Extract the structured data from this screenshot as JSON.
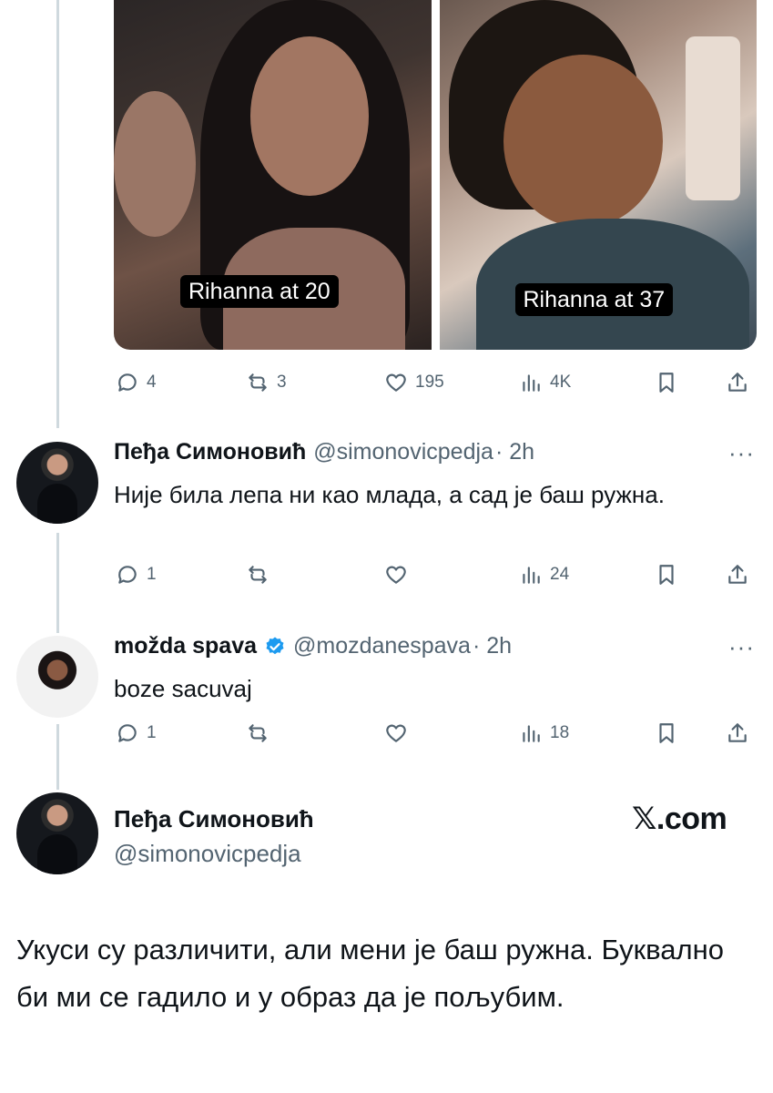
{
  "media": {
    "captions": [
      "Rihanna at 20",
      "Rihanna at 37"
    ]
  },
  "tweet_actions": {
    "replies": "4",
    "reposts": "3",
    "likes": "195",
    "views": "4K"
  },
  "replies": [
    {
      "name": "Пеђа Симоновић",
      "handle": "@simonovicpedja",
      "time": "· 2h",
      "text": "Није била лепа ни као млада, а сад је баш ружна.",
      "reply_count": "1",
      "repost_count": "",
      "like_count": "",
      "views": "24",
      "more": "···"
    },
    {
      "name": "možda spava",
      "handle": "@mozdanespava",
      "time": "· 2h",
      "text": "boze sacuvaj",
      "reply_count": "1",
      "repost_count": "",
      "like_count": "",
      "views": "18",
      "more": "···",
      "verified_color": "#1d9bf0"
    }
  ],
  "main_tweet": {
    "name": "Пеђа Симоновић",
    "handle": "@simonovicpedja",
    "source": "𝕏.com",
    "text": "Укуси су различити, али мени је баш ружна. Буквално би ми се гадило и у образ да је пољубим."
  },
  "colors": {
    "text": "#0f1419",
    "secondary": "#536471",
    "thread_line": "#cfd9de",
    "verified": "#1d9bf0"
  }
}
